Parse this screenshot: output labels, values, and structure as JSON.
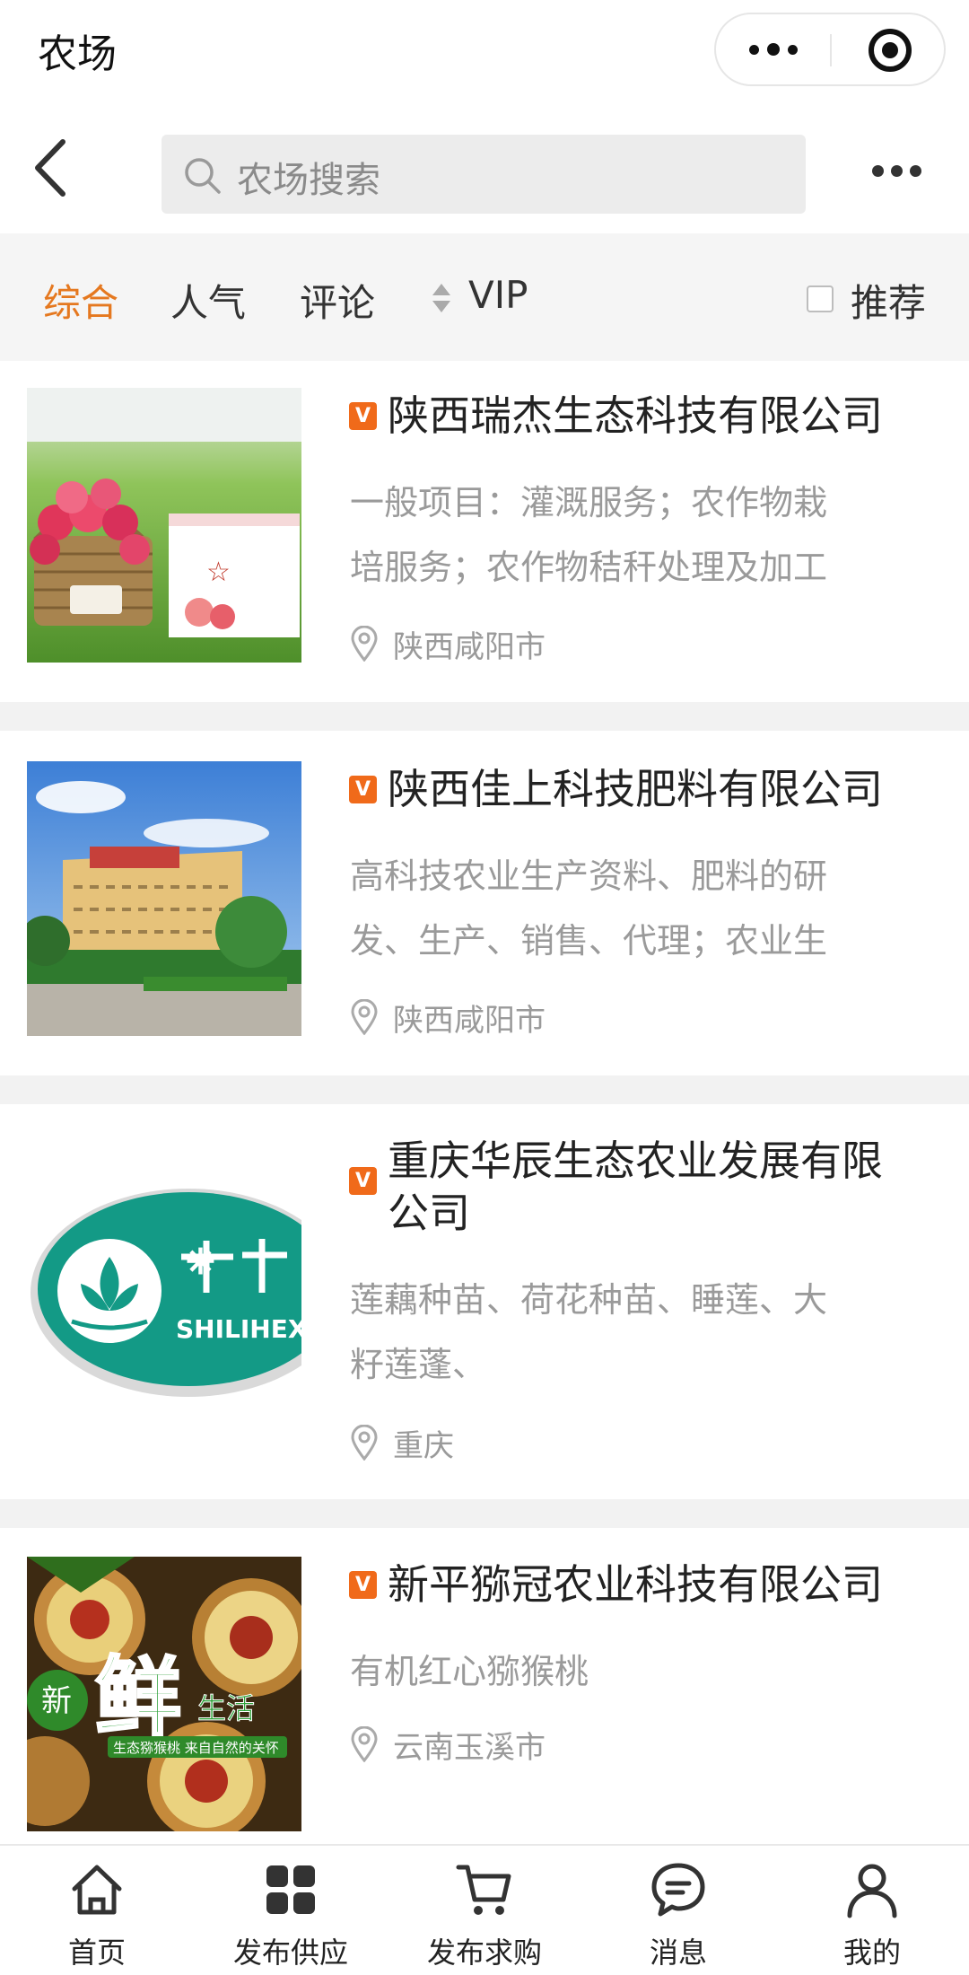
{
  "titlebar": {
    "title": "农场"
  },
  "search": {
    "placeholder": "农场搜索"
  },
  "filters": {
    "tabs": [
      "综合",
      "人气",
      "评论",
      "VIP"
    ],
    "active": "综合",
    "recommend_label": "推荐"
  },
  "farms": [
    {
      "badge": "V",
      "name": "陕西瑞杰生态科技有限公司",
      "desc_lines": [
        "一般项目：灌溉服务；农作物栽",
        "培服务；农作物秸秆处理及加工"
      ],
      "location": "陕西咸阳市",
      "image": "apple-basket-photo"
    },
    {
      "badge": "V",
      "name": "陕西佳上科技肥料有限公司",
      "desc_lines": [
        "高科技农业生产资料、肥料的研",
        "发、生产、销售、代理；农业生"
      ],
      "location": "陕西咸阳市",
      "image": "factory-building-photo"
    },
    {
      "badge": "V",
      "name_lines": [
        "重庆华辰生态农业发展有限",
        "公司"
      ],
      "desc_lines": [
        "莲藕种苗、荷花种苗、睡莲、大",
        "籽莲蓬、"
      ],
      "location": "重庆",
      "image": "lotus-logo",
      "logo_text": "SHILIHEX"
    },
    {
      "badge": "V",
      "name": "新平猕冠农业科技有限公司",
      "desc_lines": [
        "有机红心猕猴桃"
      ],
      "location": "云南玉溪市",
      "image": "kiwi-fruit-poster",
      "poster_text": {
        "a": "新",
        "b": "鲜",
        "c": "生活",
        "d": "生态猕猴桃 来自自然的关怀"
      }
    }
  ],
  "tabbar": [
    {
      "label": "首页",
      "icon": "home-icon"
    },
    {
      "label": "发布供应",
      "icon": "grid-icon"
    },
    {
      "label": "发布求购",
      "icon": "cart-icon"
    },
    {
      "label": "消息",
      "icon": "chat-icon"
    },
    {
      "label": "我的",
      "icon": "user-icon"
    }
  ],
  "colors": {
    "accent": "#e5781f",
    "badge": "#f06a1a"
  }
}
